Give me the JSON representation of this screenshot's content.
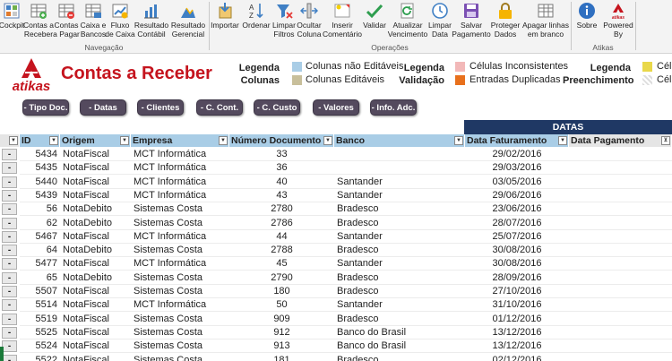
{
  "ribbon": {
    "groups": [
      {
        "label": "Navegação",
        "buttons": [
          {
            "label": "Cockpit",
            "icon": "cockpit-icon"
          },
          {
            "label": "Contas a\nReceber",
            "icon": "receivables-table-icon"
          },
          {
            "label": "Contas\na Pagar",
            "icon": "payables-table-icon"
          },
          {
            "label": "Caixa e\nBancos",
            "icon": "cash-bank-icon"
          },
          {
            "label": "Fluxo\nde Caixa",
            "icon": "cash-flow-icon"
          },
          {
            "label": "Resultado\nContábil",
            "icon": "accounting-result-icon"
          },
          {
            "label": "Resultado\nGerencial",
            "icon": "management-result-icon"
          }
        ]
      },
      {
        "label": "Operações",
        "buttons": [
          {
            "label": "Importar",
            "icon": "import-icon"
          },
          {
            "label": "Ordenar",
            "icon": "sort-az-icon"
          },
          {
            "label": "Limpar\nFiltros",
            "icon": "clear-filters-icon"
          },
          {
            "label": "Ocultar\nColuna",
            "icon": "hide-column-icon"
          },
          {
            "label": "Inserir\nComentário",
            "icon": "insert-comment-icon"
          },
          {
            "label": "Validar",
            "icon": "validate-check-icon"
          },
          {
            "label": "Atualizar\nVencimento",
            "icon": "refresh-due-icon"
          },
          {
            "label": "Limpar\nData",
            "icon": "clear-date-icon"
          },
          {
            "label": "Salvar\nPagamento",
            "icon": "save-payment-icon"
          },
          {
            "label": "Proteger\nDados",
            "icon": "lock-icon"
          },
          {
            "label": "Apagar linhas\nem branco",
            "icon": "delete-rows-icon"
          }
        ]
      },
      {
        "label": "Atikas",
        "buttons": [
          {
            "label": "Sobre",
            "icon": "info-icon"
          },
          {
            "label": "Powered\nBy",
            "icon": "atikas-logo-icon"
          }
        ]
      }
    ]
  },
  "header": {
    "logo_text": "atikas",
    "title": "Contas a Receber",
    "legend_columns_title": "Legenda\nColunas",
    "legend_columns": [
      {
        "label": "Colunas não Editáveis",
        "color": "#a9cde6"
      },
      {
        "label": "Colunas Editáveis",
        "color": "#c8bf9b"
      }
    ],
    "legend_validation_title": "Legenda\nValidação",
    "legend_validation": [
      {
        "label": "Células Inconsistentes",
        "color": "#f2b8b8"
      },
      {
        "label": "Entradas Duplicadas",
        "color": "#e8701c"
      }
    ],
    "legend_fill_title": "Legenda\nPreenchimento",
    "legend_fill": [
      {
        "label": "Célu",
        "color": "#e9d84a"
      },
      {
        "label": "Célu",
        "color": "#e0e0e0"
      }
    ]
  },
  "filters": [
    "- Tipo Doc.",
    "- Datas",
    "- Clientes",
    "- C. Cont.",
    "- C. Custo",
    "- Valores",
    "- Info. Adc."
  ],
  "table": {
    "group_header": "DATAS",
    "columns": [
      "ID",
      "Origem",
      "Empresa",
      "Número Documento",
      "Banco",
      "Data Faturamento",
      "Data Pagamento"
    ],
    "row_button": "-",
    "rows": [
      [
        "5434",
        "NotaFiscal",
        "MCT Informática",
        "33",
        "",
        "29/02/2016",
        ""
      ],
      [
        "5435",
        "NotaFiscal",
        "MCT Informática",
        "36",
        "",
        "29/03/2016",
        ""
      ],
      [
        "5440",
        "NotaFiscal",
        "MCT Informática",
        "40",
        "Santander",
        "03/05/2016",
        ""
      ],
      [
        "5439",
        "NotaFiscal",
        "MCT Informática",
        "43",
        "Santander",
        "29/06/2016",
        ""
      ],
      [
        "56",
        "NotaDebito",
        "Sistemas Costa",
        "2780",
        "Bradesco",
        "23/06/2016",
        ""
      ],
      [
        "62",
        "NotaDebito",
        "Sistemas Costa",
        "2786",
        "Bradesco",
        "28/07/2016",
        ""
      ],
      [
        "5467",
        "NotaFiscal",
        "MCT Informática",
        "44",
        "Santander",
        "25/07/2016",
        ""
      ],
      [
        "64",
        "NotaDebito",
        "Sistemas Costa",
        "2788",
        "Bradesco",
        "30/08/2016",
        ""
      ],
      [
        "5477",
        "NotaFiscal",
        "MCT Informática",
        "45",
        "Santander",
        "30/08/2016",
        ""
      ],
      [
        "65",
        "NotaDebito",
        "Sistemas Costa",
        "2790",
        "Bradesco",
        "28/09/2016",
        ""
      ],
      [
        "5507",
        "NotaFiscal",
        "Sistemas Costa",
        "180",
        "Bradesco",
        "27/10/2016",
        ""
      ],
      [
        "5514",
        "NotaFiscal",
        "MCT Informática",
        "50",
        "Santander",
        "31/10/2016",
        ""
      ],
      [
        "5519",
        "NotaFiscal",
        "Sistemas Costa",
        "909",
        "Bradesco",
        "01/12/2016",
        ""
      ],
      [
        "5525",
        "NotaFiscal",
        "Sistemas Costa",
        "912",
        "Banco do Brasil",
        "13/12/2016",
        ""
      ],
      [
        "5524",
        "NotaFiscal",
        "Sistemas Costa",
        "913",
        "Banco do Brasil",
        "13/12/2016",
        ""
      ],
      [
        "5522",
        "NotaFiscal",
        "Sistemas Costa",
        "181",
        "Bradesco",
        "02/12/2016",
        ""
      ]
    ]
  }
}
